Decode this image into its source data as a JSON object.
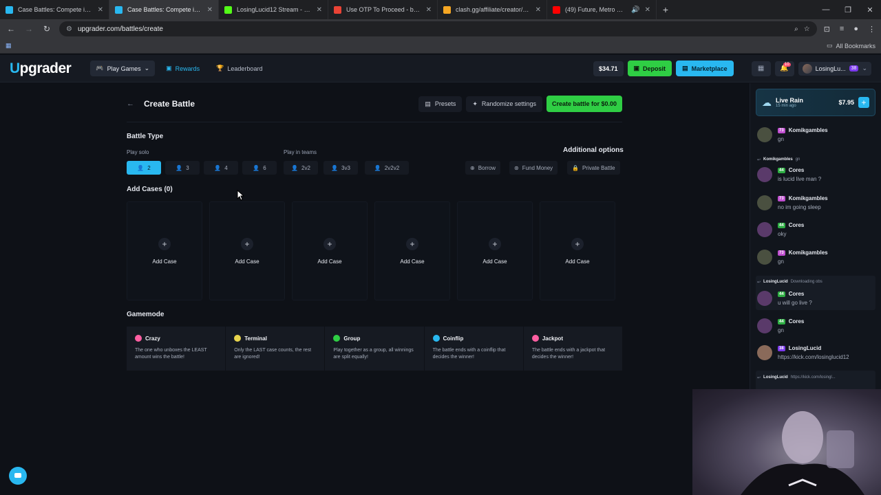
{
  "browser": {
    "tabs": [
      {
        "title": "Case Battles: Compete in Myste",
        "favicon_color": "#29b8f0"
      },
      {
        "title": "Case Battles: Compete in Myste",
        "favicon_color": "#29b8f0",
        "active": true
      },
      {
        "title": "LosingLucid12 Stream - Watch L",
        "favicon_color": "#53fc18"
      },
      {
        "title": "Use OTP To Proceed - beatsfor",
        "favicon_color": "#ea4335"
      },
      {
        "title": "clash.gg/affiliate/creator/DAPT",
        "favicon_color": "#f5a623"
      },
      {
        "title": "(49) Future, Metro Boomin",
        "favicon_color": "#ff0000"
      }
    ],
    "url": "upgrader.com/battles/create",
    "bookmarks_label": "All Bookmarks"
  },
  "header": {
    "logo_prefix": "U",
    "logo_rest": "pgrader",
    "nav": {
      "play": "Play Games",
      "rewards": "Rewards",
      "leaderboard": "Leaderboard"
    },
    "balance": "$34.71",
    "deposit": "Deposit",
    "marketplace": "Marketplace",
    "notif_count": "10",
    "username": "LosingLu...",
    "level": "38"
  },
  "page": {
    "title": "Create Battle",
    "presets": "Presets",
    "randomize": "Randomize settings",
    "create": "Create battle for $0.00",
    "battle_type": "Battle Type",
    "play_solo": "Play solo",
    "play_teams": "Play in teams",
    "additional_options": "Additional options",
    "solo_modes": [
      "2",
      "3",
      "4",
      "6"
    ],
    "team_modes": [
      "2v2",
      "3v3",
      "2v2v2"
    ],
    "options": {
      "borrow": "Borrow",
      "fund": "Fund Money",
      "private": "Private Battle"
    },
    "add_cases_title": "Add Cases (0)",
    "add_case_label": "Add Case",
    "gamemode_title": "Gamemode",
    "gamemodes": [
      {
        "name": "Crazy",
        "desc": "The one who unboxes the LEAST amount wins the battle!",
        "color": "#ff5fa2"
      },
      {
        "name": "Terminal",
        "desc": "Only the LAST case counts, the rest are ignored!",
        "color": "#e8d44d"
      },
      {
        "name": "Group",
        "desc": "Play together as a group, all winnings are split equally!",
        "color": "#2fce44"
      },
      {
        "name": "Coinflip",
        "desc": "The battle ends with a coinflip that decides the winner!",
        "color": "#29b8f0"
      },
      {
        "name": "Jackpot",
        "desc": "The battle ends with a jackpot that decides the winner!",
        "color": "#ff5fa2"
      }
    ]
  },
  "chat": {
    "rain": {
      "title": "Live Rain",
      "sub": "15 min ago",
      "amount": "$7.95"
    },
    "messages": [
      {
        "type": "msg",
        "name": "Komikgambles",
        "level": "73",
        "text": "gn",
        "level_color": "#c04fd0"
      },
      {
        "type": "reply",
        "who": "Komikgambles",
        "what": "gn"
      },
      {
        "type": "msg",
        "name": "Cores",
        "level": "44",
        "text": "is lucid live man ?",
        "level_color": "#2fae44"
      },
      {
        "type": "msg",
        "name": "Komikgambles",
        "level": "73",
        "text": "no im going sleep",
        "level_color": "#c04fd0"
      },
      {
        "type": "msg",
        "name": "Cores",
        "level": "44",
        "text": "oky",
        "level_color": "#2fae44"
      },
      {
        "type": "msg",
        "name": "Komikgambles",
        "level": "73",
        "text": "gn",
        "level_color": "#c04fd0"
      },
      {
        "type": "reply",
        "who": "LosingLucid",
        "what": "Downloading obs"
      },
      {
        "type": "msg",
        "name": "Cores",
        "level": "44",
        "text": "u will go live ?",
        "level_color": "#2fae44"
      },
      {
        "type": "msg",
        "name": "Cores",
        "level": "44",
        "text": "gn",
        "level_color": "#2fae44"
      },
      {
        "type": "msg",
        "name": "LosingLucid",
        "level": "38",
        "text": "https://kick.com/losinglucid12",
        "level_color": "#7c3aed"
      },
      {
        "type": "reply",
        "who": "LosingLucid",
        "what": "https://kick.com/losingl..."
      }
    ]
  }
}
